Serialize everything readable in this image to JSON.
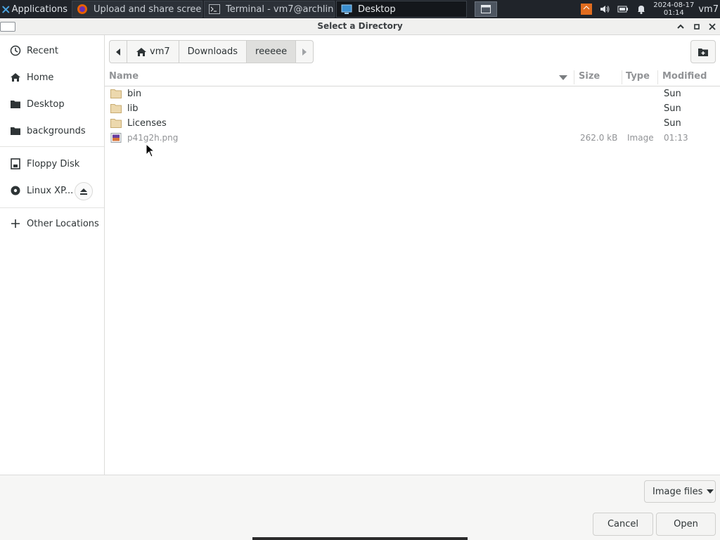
{
  "taskbar": {
    "apps_label": "Applications",
    "tasks": [
      {
        "label": "Upload and share screen..."
      },
      {
        "label": "Terminal - vm7@archlinu..."
      },
      {
        "label": "Desktop"
      }
    ],
    "clock_date": "2024-08-17",
    "clock_time": "01:14",
    "user": "vm7"
  },
  "dialog": {
    "title": "Select a Directory"
  },
  "sidebar": {
    "items": [
      {
        "label": "Recent",
        "icon": "clock-icon"
      },
      {
        "label": "Home",
        "icon": "home-icon"
      },
      {
        "label": "Desktop",
        "icon": "folder-icon"
      },
      {
        "label": "backgrounds",
        "icon": "folder-icon"
      },
      {
        "label": "Floppy Disk",
        "icon": "floppy-icon"
      },
      {
        "label": "Linux XP...",
        "icon": "disc-icon"
      },
      {
        "label": "Other Locations",
        "icon": "plus-icon"
      }
    ]
  },
  "pathbar": {
    "segments": [
      "vm7",
      "Downloads",
      "reeeee"
    ]
  },
  "columns": {
    "name": "Name",
    "size": "Size",
    "type": "Type",
    "modified": "Modified"
  },
  "files": [
    {
      "name": "bin",
      "size": "",
      "type": "",
      "modified": "Sun",
      "kind": "folder"
    },
    {
      "name": "lib",
      "size": "",
      "type": "",
      "modified": "Sun",
      "kind": "folder"
    },
    {
      "name": "Licenses",
      "size": "",
      "type": "",
      "modified": "Sun",
      "kind": "folder"
    },
    {
      "name": "p41g2h.png",
      "size": "262.0 kB",
      "type": "Image",
      "modified": "01:13",
      "kind": "image"
    }
  ],
  "footer": {
    "filter_label": "Image files",
    "cancel_label": "Cancel",
    "open_label": "Open"
  },
  "colors": {
    "folder": "#e8d3a6",
    "taskbar_bg": "#20242a",
    "dialog_bg": "#f6f6f5"
  }
}
